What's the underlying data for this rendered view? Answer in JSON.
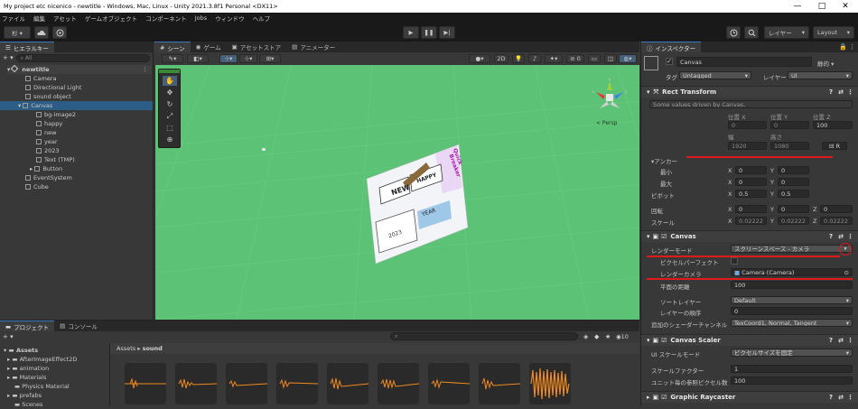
{
  "window": {
    "title": "My project etc nicenico - newtitle - Windows, Mac, Linux - Unity 2021.3.8f1 Personal <DX11>",
    "minimize": "—",
    "maximize": "□",
    "close": "✕"
  },
  "menu": [
    "ファイル",
    "編集",
    "アセット",
    "ゲームオブジェクト",
    "コンポーネント",
    "Jobs",
    "ウィンドウ",
    "ヘルプ"
  ],
  "toolbar": {
    "account": "杉 ▾",
    "cloud_icon": "cloud-icon",
    "collab_icon": "collab-icon",
    "play": "▶",
    "pause": "❚❚",
    "step": "▶|",
    "history_icon": "history-icon",
    "search_icon": "search-icon",
    "layers": "レイヤー",
    "layout": "Layout"
  },
  "hierarchy": {
    "tab": "ヒエラルキー",
    "add": "+ ▾",
    "search_placeholder": "All",
    "root": "newtitle",
    "items": [
      "Camera",
      "Directional Light",
      "sound object",
      "Canvas",
      "bg-image2",
      "happy",
      "new",
      "year",
      "2023",
      "Text (TMP)",
      "Button",
      "EventSystem",
      "Cube"
    ]
  },
  "scene": {
    "tabs": [
      "シーン",
      "ゲーム",
      "アセットストア",
      "アニメーター"
    ],
    "persp": "< Persp",
    "mode_2d": "2D",
    "gizmo_axes": [
      "y",
      "x",
      "z"
    ],
    "tools": [
      "hand-tool-icon",
      "move-tool-icon",
      "rotate-tool-icon",
      "scale-tool-icon",
      "rect-tool-icon",
      "transform-tool-icon",
      "custom-tool-icon"
    ],
    "card_texts": [
      "HAPPY",
      "NEW",
      "YEAR",
      "2023",
      "Quick",
      "Breaker"
    ]
  },
  "project": {
    "tabs": [
      "プロジェクト",
      "コンソール"
    ],
    "add": "+ ▾",
    "search_placeholder": "",
    "count": "10",
    "tree_root": "Assets",
    "tree": [
      "AfterImageEffect2D",
      "animation",
      "Materials",
      "Physics Material",
      "prefabs",
      "Scenes"
    ],
    "breadcrumb": [
      "Assets",
      "sound"
    ],
    "assets_count": 9
  },
  "inspector": {
    "tab": "インスペクター",
    "object_name": "Canvas",
    "static": "静的",
    "tag_label": "タグ",
    "tag_value": "Untagged",
    "layer_label": "レイヤー",
    "layer_value": "UI",
    "rect_transform": {
      "header": "Rect Transform",
      "note": "Some values driven by Canvas.",
      "pos_headers": [
        "位置 X",
        "位置 Y",
        "位置 Z"
      ],
      "pos_values": [
        "0",
        "0",
        "100"
      ],
      "size_headers": [
        "幅",
        "高さ"
      ],
      "size_values": [
        "1920",
        "1080"
      ],
      "r_button": "R",
      "anchor_label": "アンカー",
      "min_label": "最小",
      "min_values": [
        "0",
        "0"
      ],
      "max_label": "最大",
      "max_values": [
        "0",
        "0"
      ],
      "pivot_label": "ピボット",
      "pivot_values": [
        "0.5",
        "0.5"
      ],
      "rotation_label": "回転",
      "rotation_values": [
        "0",
        "0",
        "0"
      ],
      "scale_label": "スケール",
      "scale_values": [
        "0.02222",
        "0.02222",
        "0.02222"
      ],
      "axis_labels": [
        "X",
        "Y",
        "Z"
      ]
    },
    "canvas": {
      "header": "Canvas",
      "render_mode_label": "レンダーモード",
      "render_mode_value": "スクリーンスペース - カメラ",
      "pixel_perfect_label": "ピクセルパーフェクト",
      "render_camera_label": "レンダーカメラ",
      "render_camera_value": "Camera (Camera)",
      "plane_distance_label": "平面の距離",
      "plane_distance_value": "100",
      "sorting_layer_label": "ソートレイヤー",
      "sorting_layer_value": "Default",
      "order_label": "レイヤーの順序",
      "order_value": "0",
      "shader_channels_label": "追加のシェーダーチャンネル",
      "shader_channels_value": "TexCoord1, Normal, Tangent"
    },
    "canvas_scaler": {
      "header": "Canvas Scaler",
      "ui_scale_mode_label": "UI スケールモード",
      "ui_scale_mode_value": "ピクセルサイズを固定",
      "scale_factor_label": "スケールファクター",
      "scale_factor_value": "1",
      "ref_pixels_label": "ユニット毎の参照ピクセル数",
      "ref_pixels_value": "100"
    },
    "graphic_raycaster": {
      "header": "Graphic Raycaster"
    }
  },
  "colors": {
    "scene_bg": "#5cc376",
    "accent_red": "#e01919",
    "selection": "#2c5d87"
  }
}
